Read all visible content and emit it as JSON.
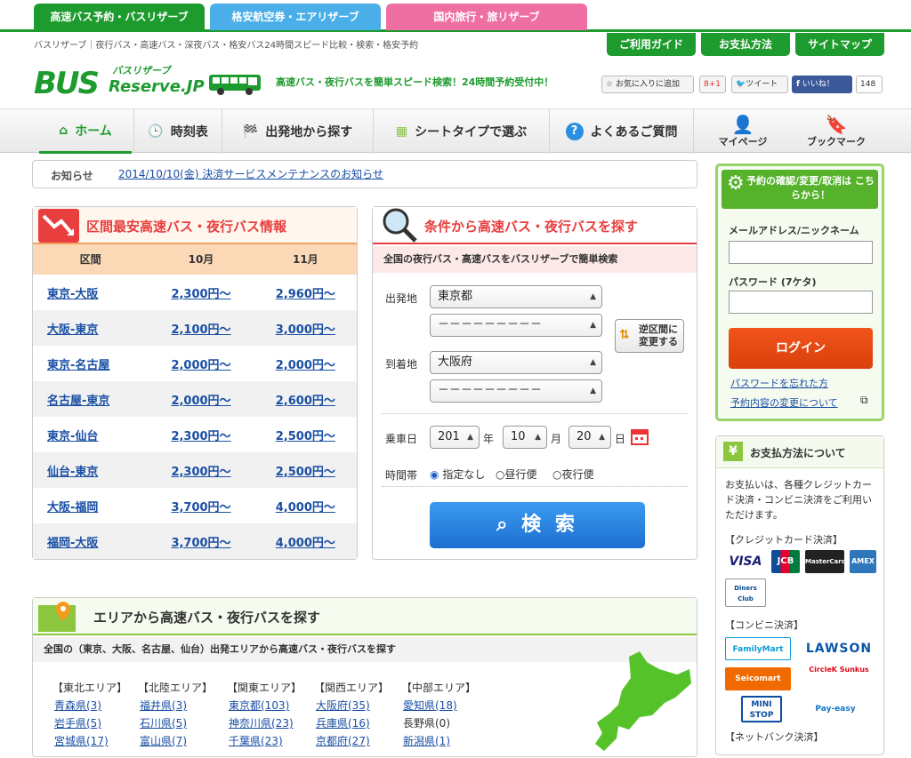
{
  "top_tabs": [
    {
      "label": "高速バス予約・バスリザーブ",
      "color": "#1e9b2e"
    },
    {
      "label": "格安航空券・エアリザーブ",
      "color": "#4aaee8"
    },
    {
      "label": "国内旅行・旅リザーブ",
      "color": "#ef6fa2"
    }
  ],
  "breadcrumb": "バスリザーブ｜夜行バス・高速バス・深夜バス・格安バス24時間スピード比較・検索・格安予約",
  "header_buttons": [
    "ご利用ガイド",
    "お支払方法",
    "サイトマップ"
  ],
  "logo": {
    "main": "BUS",
    "sub": "Reserve.JP",
    "kana": "バスリザーブ"
  },
  "tagline": "高速バス・夜行バスを簡単スピード検索！24時間予約受付中！",
  "social": {
    "fav": "お気に入りに追加",
    "gplus": "8+1",
    "tweet": "ツイート",
    "like": "いいね！",
    "like_count": "148"
  },
  "nav": [
    {
      "label": "ホーム",
      "icon": "home-icon"
    },
    {
      "label": "時刻表",
      "icon": "clock-icon"
    },
    {
      "label": "出発地から探す",
      "icon": "flag-icon"
    },
    {
      "label": "シートタイプで選ぶ",
      "icon": "seat-icon"
    },
    {
      "label": "よくあるご質問",
      "icon": "question-icon"
    },
    {
      "label": "マイページ",
      "icon": "person-icon"
    },
    {
      "label": "ブックマーク",
      "icon": "bookmark-icon"
    }
  ],
  "news": {
    "label": "お知らせ",
    "text": "2014/10/10(金) 決済サービスメンテナンスのお知らせ"
  },
  "fares": {
    "title": "区間最安高速バス・夜行バス情報",
    "cols": [
      "区間",
      "10月",
      "11月"
    ],
    "rows": [
      {
        "route": "東京-大阪",
        "oct": "2,300円～",
        "nov": "2,960円～"
      },
      {
        "route": "大阪-東京",
        "oct": "2,100円～",
        "nov": "3,000円～"
      },
      {
        "route": "東京-名古屋",
        "oct": "2,000円～",
        "nov": "2,000円～"
      },
      {
        "route": "名古屋-東京",
        "oct": "2,000円～",
        "nov": "2,600円～"
      },
      {
        "route": "東京-仙台",
        "oct": "2,300円～",
        "nov": "2,500円～"
      },
      {
        "route": "仙台-東京",
        "oct": "2,300円～",
        "nov": "2,500円～"
      },
      {
        "route": "大阪-福岡",
        "oct": "3,700円～",
        "nov": "4,000円～"
      },
      {
        "route": "福岡-大阪",
        "oct": "3,700円～",
        "nov": "4,000円～"
      }
    ]
  },
  "search": {
    "title": "条件から高速バス・夜行バスを探す",
    "subtitle": "全国の夜行バス・高速バスをバスリザーブで簡単検索",
    "dep_label": "出発地",
    "dep_value": "東京都",
    "dep_sub": "－－－－－－－－－",
    "arr_label": "到着地",
    "arr_value": "大阪府",
    "arr_sub": "－－－－－－－－－",
    "swap": "逆区間に変更する",
    "date_label": "乗車日",
    "year": "201",
    "year_unit": "年",
    "month": "10",
    "month_unit": "月",
    "day": "20",
    "day_unit": "日",
    "time_label": "時間帯",
    "time_options": [
      "指定なし",
      "昼行便",
      "夜行便"
    ],
    "button": "検 索"
  },
  "login": {
    "title": "予約の確認/変更/取消は こちらから！",
    "email_label": "メールアドレス/ニックネーム",
    "pw_label": "パスワード (7ケタ)",
    "button": "ログイン",
    "forgot": "パスワードを忘れた方",
    "change": "予約内容の変更について"
  },
  "payment": {
    "title": "お支払方法について",
    "desc": "お支払いは、各種クレジットカード決済・コンビニ決済をご利用いただけます。",
    "credit_label": "【クレジットカード決済】",
    "cards": [
      "VISA",
      "JCB",
      "MasterCard",
      "AMEX",
      "Diners Club"
    ],
    "conv_label": "【コンビニ決済】",
    "stores": [
      "FamilyMart",
      "LAWSON",
      "Seicomart",
      "CircleK Sunkus",
      "MINI STOP",
      "Pay-easy"
    ],
    "net_label": "【ネットバンク決済】"
  },
  "area": {
    "title": "エリアから高速バス・夜行バスを探す",
    "subtitle": "全国の（東京、大阪、名古屋、仙台）出発エリアから高速バス・夜行バスを探す",
    "regions": [
      "【東北エリア】",
      "【北陸エリア】",
      "【関東エリア】",
      "【関西エリア】",
      "【中部エリア】"
    ],
    "rows": [
      [
        "青森県(3)",
        "福井県(3)",
        "東京都(103)",
        "大阪府(35)",
        "愛知県(18)"
      ],
      [
        "岩手県(5)",
        "石川県(5)",
        "神奈川県(23)",
        "兵庫県(16)",
        "長野県(0)"
      ],
      [
        "宮城県(17)",
        "富山県(7)",
        "千葉県(23)",
        "京都府(27)",
        "新潟県(1)"
      ]
    ]
  }
}
